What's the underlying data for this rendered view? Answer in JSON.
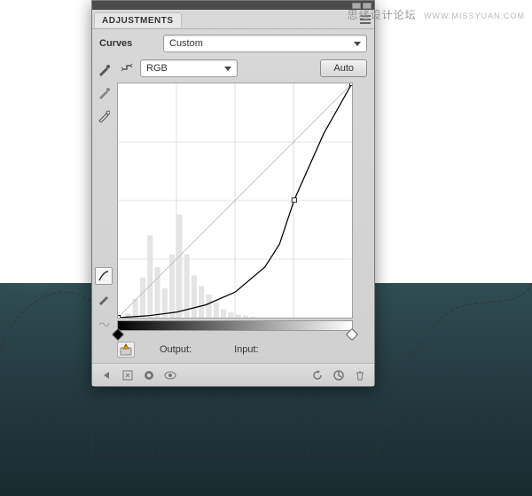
{
  "watermark": {
    "cn": "思绪设计论坛",
    "url": "WWW.MISSYUAN.COM"
  },
  "panel": {
    "tab_label": "ADJUSTMENTS",
    "adjustment_label": "Curves",
    "preset_value": "Custom",
    "channel": "RGB",
    "auto_label": "Auto",
    "output_label": "Output:",
    "input_label": "Input:",
    "output_value": "",
    "input_value": ""
  },
  "icons": {
    "menu": "menu-icon",
    "target": "target-adjust-icon",
    "eyedropper_black": "eyedropper-black-icon",
    "eyedropper_gray": "eyedropper-gray-icon",
    "eyedropper_white": "eyedropper-white-icon",
    "curve_tool": "curve-tool-icon",
    "pencil_tool": "pencil-tool-icon",
    "smooth_tool": "smooth-tool-icon",
    "warn": "layer-warning-icon",
    "clip": "clip-to-layer-icon",
    "prev": "return-to-previous-icon",
    "reset": "reset-default-icon",
    "visibility": "toggle-visibility-icon",
    "expand": "expand-icon",
    "reload": "reset-icon",
    "trash": "delete-icon"
  },
  "chart_data": {
    "type": "line",
    "title": "Curves",
    "xlabel": "Input",
    "ylabel": "Output",
    "xlim": [
      0,
      255
    ],
    "ylim": [
      0,
      255
    ],
    "series": [
      {
        "name": "identity-baseline",
        "x": [
          0,
          255
        ],
        "y": [
          0,
          255
        ]
      },
      {
        "name": "curve",
        "x": [
          0,
          32,
          64,
          96,
          128,
          160,
          176,
          192,
          224,
          255
        ],
        "y": [
          0,
          2,
          6,
          14,
          28,
          55,
          80,
          128,
          200,
          255
        ]
      }
    ],
    "control_points": [
      {
        "x": 0,
        "y": 0
      },
      {
        "x": 192,
        "y": 128
      },
      {
        "x": 255,
        "y": 255
      }
    ],
    "histogram_bins": [
      {
        "x": 0,
        "h": 0
      },
      {
        "x": 8,
        "h": 4
      },
      {
        "x": 16,
        "h": 18
      },
      {
        "x": 24,
        "h": 38
      },
      {
        "x": 32,
        "h": 78
      },
      {
        "x": 40,
        "h": 48
      },
      {
        "x": 48,
        "h": 28
      },
      {
        "x": 56,
        "h": 60
      },
      {
        "x": 64,
        "h": 98
      },
      {
        "x": 72,
        "h": 60
      },
      {
        "x": 80,
        "h": 40
      },
      {
        "x": 88,
        "h": 30
      },
      {
        "x": 96,
        "h": 22
      },
      {
        "x": 104,
        "h": 14
      },
      {
        "x": 112,
        "h": 8
      },
      {
        "x": 120,
        "h": 5
      },
      {
        "x": 128,
        "h": 3
      },
      {
        "x": 136,
        "h": 2
      },
      {
        "x": 144,
        "h": 1
      }
    ],
    "grid": {
      "x_divisions": 4,
      "y_divisions": 4
    }
  },
  "colors": {
    "panel_bg": "#d4d4d4",
    "panel_border": "#7a7a7a",
    "sea": "#253d42"
  }
}
